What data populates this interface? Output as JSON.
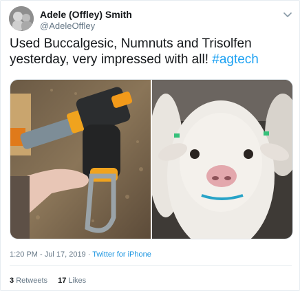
{
  "tweet": {
    "author_name": "Adele (Offley) Smith",
    "author_handle": "@AdeleOffley",
    "text_main": "Used Buccalgesic, Numnuts and Trisolfen yesterday, very impressed with all! ",
    "hashtag": "#agtech",
    "time": "1:20 PM - Jul 17, 2019",
    "separator": " · ",
    "source": "Twitter for iPhone"
  },
  "stats": {
    "retweets_count": "3",
    "retweets_label": "Retweets",
    "likes_count": "17",
    "likes_label": "Likes"
  },
  "icons": {
    "menu": "chevron-down-icon"
  },
  "colors": {
    "link": "#1da1f2",
    "text": "#14171a",
    "muted": "#657786",
    "border": "#e6ecf0"
  }
}
